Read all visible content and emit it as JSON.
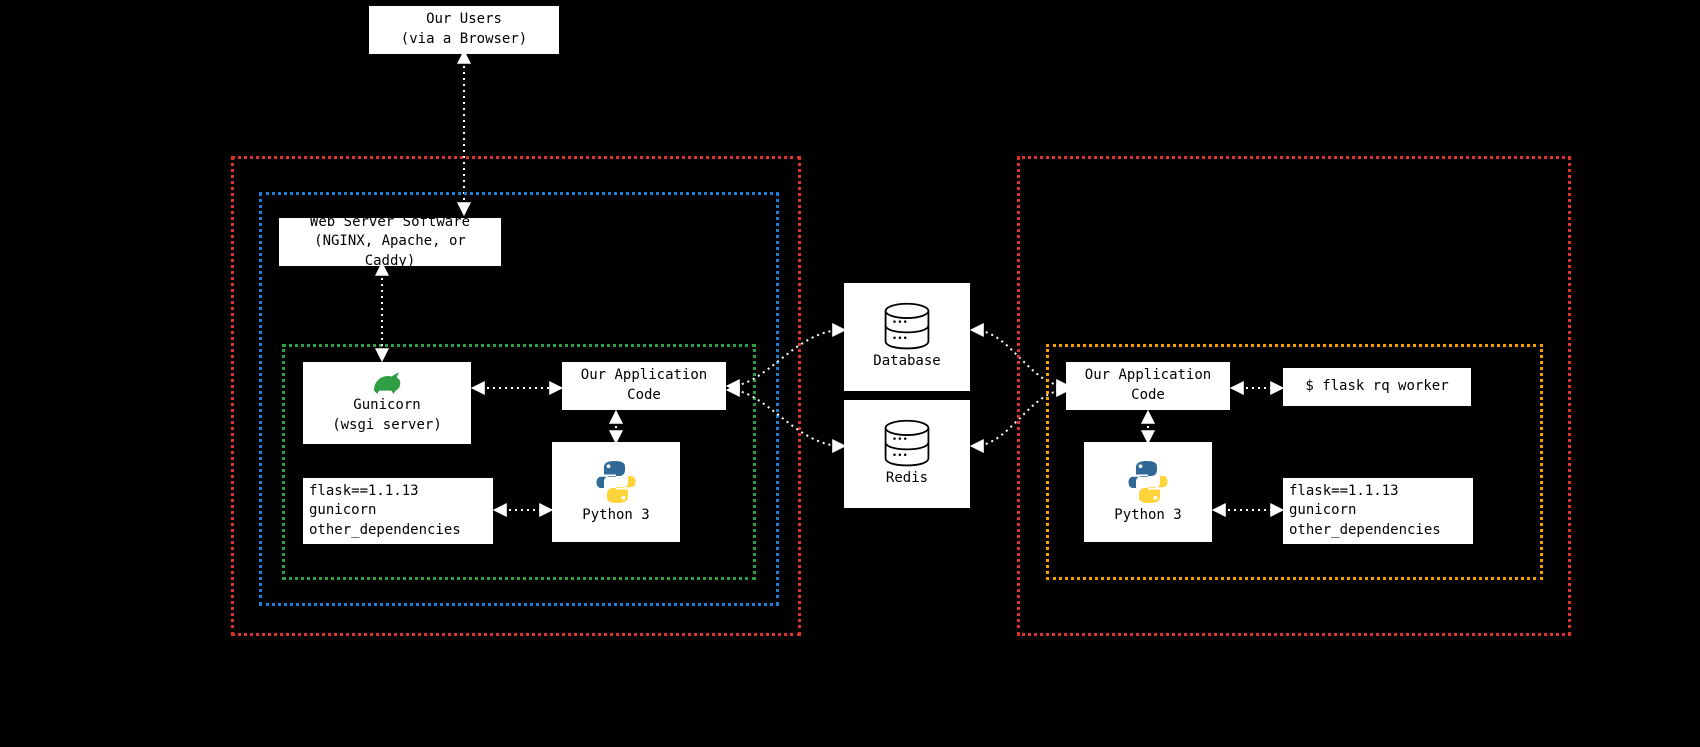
{
  "users": {
    "line1": "Our Users",
    "line2": "(via a Browser)"
  },
  "webserver": {
    "line1": "Web Server Software",
    "line2": "(NGINX, Apache, or Caddy)"
  },
  "gunicorn": {
    "name": "Gunicorn",
    "sub": "(wsgi server)"
  },
  "appcode": {
    "line1": "Our Application",
    "line2": "Code"
  },
  "deps": {
    "l1": "flask==1.1.13",
    "l2": "gunicorn",
    "l3": "other_dependencies"
  },
  "python": {
    "label": "Python 3"
  },
  "database": {
    "label": "Database"
  },
  "redis": {
    "label": "Redis"
  },
  "worker": {
    "cmd": "$ flask rq worker"
  }
}
